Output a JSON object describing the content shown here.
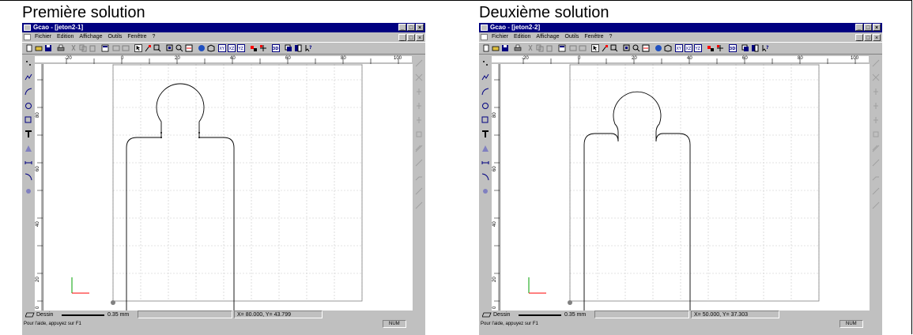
{
  "panels": [
    {
      "caption": "Première solution",
      "title": "Gcao - [jeton2-1]",
      "menu": [
        "Fichier",
        "Edition",
        "Affichage",
        "Outils",
        "Fenêtre",
        "?"
      ],
      "h_ticks": [
        "-20",
        "0",
        "20",
        "40",
        "60",
        "80",
        "100"
      ],
      "v_ticks": [
        "80",
        "60",
        "40",
        "20",
        "0"
      ],
      "status": {
        "layer": "Dessin",
        "thickness": "0.35 mm",
        "coords": "X=  80.000, Y=  43.799",
        "help": "Pour l'aide, appuyez sur F1",
        "num": "NUM"
      }
    },
    {
      "caption": "Deuxième solution",
      "title": "Gcao - [jeton2-2]",
      "menu": [
        "Fichier",
        "Edition",
        "Affichage",
        "Outils",
        "Fenêtre",
        "?"
      ],
      "h_ticks": [
        "-20",
        "0",
        "20",
        "40",
        "60",
        "80",
        "100"
      ],
      "v_ticks": [
        "80",
        "60",
        "40",
        "20",
        "0"
      ],
      "status": {
        "layer": "Dessin",
        "thickness": "0.35 mm",
        "coords": "X=  50.000, Y=  37.303",
        "help": "Pour l'aide, appuyez sur F1",
        "num": "NUM"
      }
    }
  ],
  "window_buttons": [
    "_",
    "□",
    "×"
  ],
  "colors": {
    "titlebar": "#000080",
    "chrome": "#c0c0c0",
    "axis_x": "#ff0000",
    "axis_y": "#00a000"
  }
}
